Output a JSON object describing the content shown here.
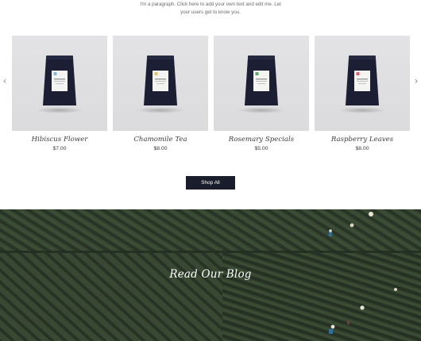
{
  "intro": {
    "line1": "I'm a paragraph. Click here to add your own text and edit me. Let",
    "line2": "your users get to know you."
  },
  "gallery": {
    "prev_icon": "chevron-left-icon",
    "next_icon": "chevron-right-icon",
    "prev_glyph": "‹",
    "next_glyph": "›",
    "products": [
      {
        "name": "Hibiscus Flower",
        "price": "$7.00",
        "label_color": "#8fb3d9"
      },
      {
        "name": "Chamomile Tea",
        "price": "$8.00",
        "label_color": "#e2c36a"
      },
      {
        "name": "Rosemary Specials",
        "price": "$5.00",
        "label_color": "#5aa865"
      },
      {
        "name": "Raspberry Leaves",
        "price": "$8.00",
        "label_color": "#d9616e"
      }
    ]
  },
  "shop_button": {
    "label": "Shop All"
  },
  "blog_banner": {
    "title": "Read Our Blog"
  }
}
